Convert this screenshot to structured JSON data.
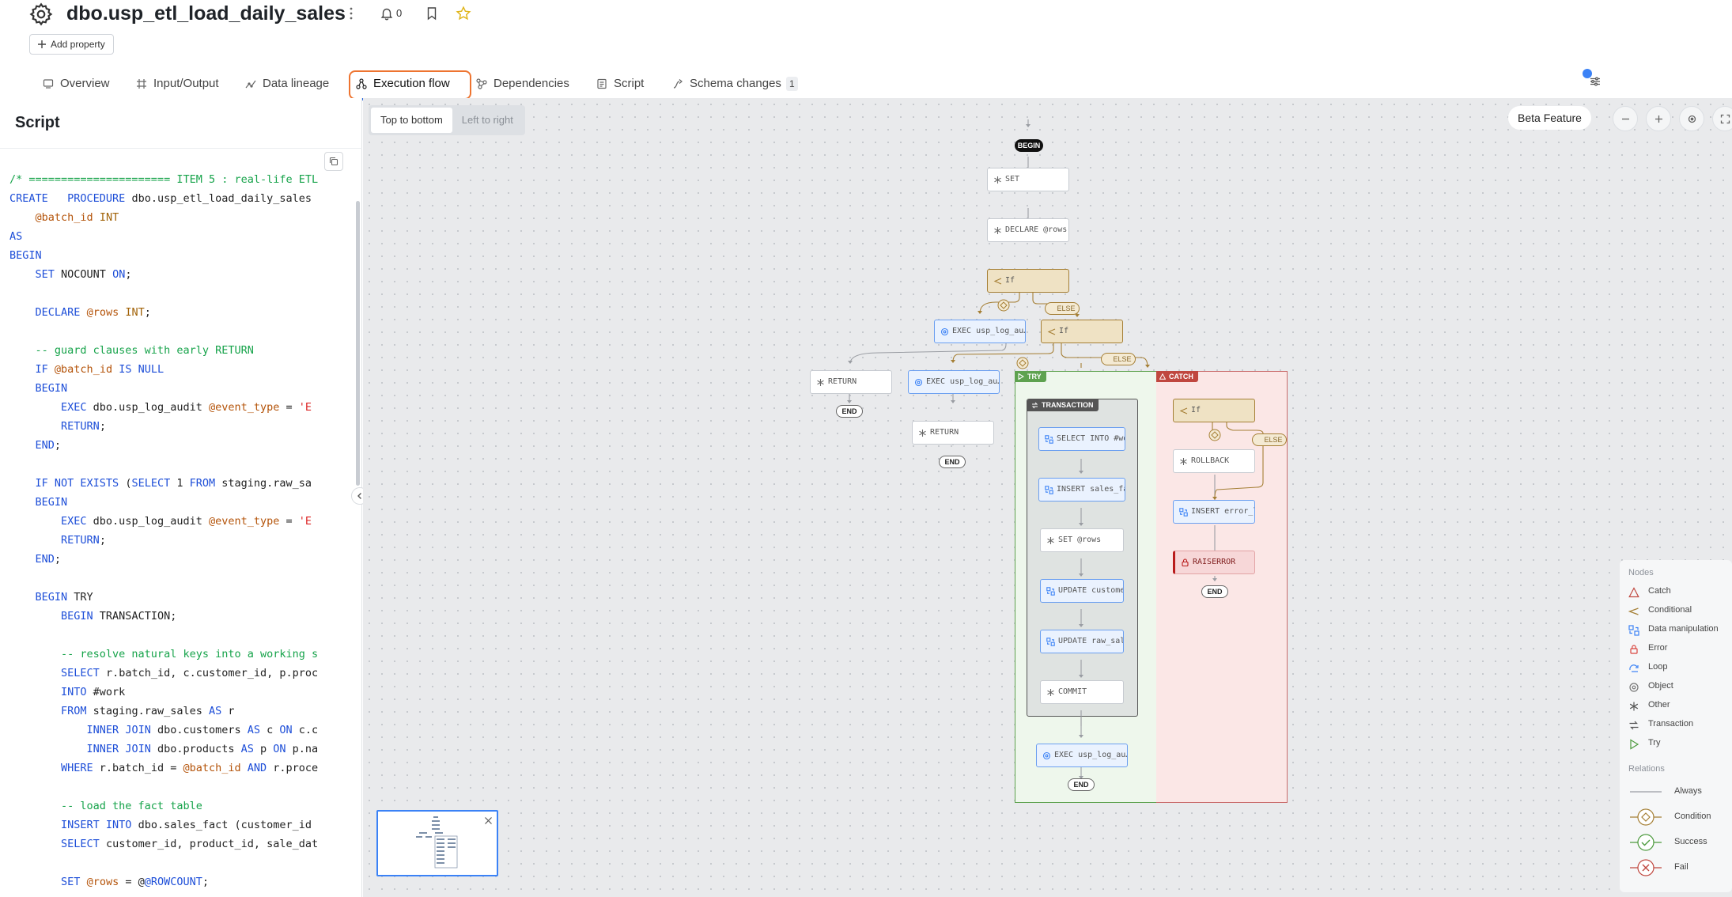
{
  "header": {
    "title": "dbo.usp_etl_load_daily_sales",
    "notifications_count": "0",
    "add_property_label": "Add property"
  },
  "tabs": [
    {
      "label": "Overview"
    },
    {
      "label": "Input/Output"
    },
    {
      "label": "Data lineage"
    },
    {
      "label": "Execution flow"
    },
    {
      "label": "Dependencies"
    },
    {
      "label": "Script"
    },
    {
      "label": "Schema changes",
      "badge": "1"
    }
  ],
  "active_tab": "Execution flow",
  "script_panel": {
    "title": "Script",
    "lines": [
      [
        {
          "t": "/* ====================== ITEM 5 : real-life ETL",
          "c": "cc"
        }
      ],
      [
        {
          "t": "CREATE   PROCEDURE",
          "c": "kw"
        },
        {
          "t": " dbo.usp_etl_load_daily_sales",
          "c": ""
        }
      ],
      [
        {
          "t": "    ",
          "c": ""
        },
        {
          "t": "@batch_id",
          "c": "vr"
        },
        {
          "t": " ",
          "c": ""
        },
        {
          "t": "INT",
          "c": "ty"
        }
      ],
      [
        {
          "t": "AS",
          "c": "kw"
        }
      ],
      [
        {
          "t": "BEGIN",
          "c": "kw"
        }
      ],
      [
        {
          "t": "    ",
          "c": ""
        },
        {
          "t": "SET",
          "c": "kw"
        },
        {
          "t": " NOCOUNT ",
          "c": ""
        },
        {
          "t": "ON",
          "c": "kw"
        },
        {
          "t": ";",
          "c": ""
        }
      ],
      [
        {
          "t": "",
          "c": ""
        }
      ],
      [
        {
          "t": "    ",
          "c": ""
        },
        {
          "t": "DECLARE",
          "c": "kw"
        },
        {
          "t": " ",
          "c": ""
        },
        {
          "t": "@rows",
          "c": "vr"
        },
        {
          "t": " ",
          "c": ""
        },
        {
          "t": "INT",
          "c": "ty"
        },
        {
          "t": ";",
          "c": ""
        }
      ],
      [
        {
          "t": "",
          "c": ""
        }
      ],
      [
        {
          "t": "    -- guard clauses with early RETURN",
          "c": "cc"
        }
      ],
      [
        {
          "t": "    ",
          "c": ""
        },
        {
          "t": "IF",
          "c": "kw"
        },
        {
          "t": " ",
          "c": ""
        },
        {
          "t": "@batch_id",
          "c": "vr"
        },
        {
          "t": " ",
          "c": ""
        },
        {
          "t": "IS NULL",
          "c": "kw"
        }
      ],
      [
        {
          "t": "    ",
          "c": ""
        },
        {
          "t": "BEGIN",
          "c": "kw"
        }
      ],
      [
        {
          "t": "        ",
          "c": ""
        },
        {
          "t": "EXEC",
          "c": "kw"
        },
        {
          "t": " dbo.usp_log_audit ",
          "c": ""
        },
        {
          "t": "@event_type",
          "c": "vr"
        },
        {
          "t": " = ",
          "c": ""
        },
        {
          "t": "'E",
          "c": "st"
        }
      ],
      [
        {
          "t": "        ",
          "c": ""
        },
        {
          "t": "RETURN",
          "c": "kw"
        },
        {
          "t": ";",
          "c": ""
        }
      ],
      [
        {
          "t": "    ",
          "c": ""
        },
        {
          "t": "END",
          "c": "kw"
        },
        {
          "t": ";",
          "c": ""
        }
      ],
      [
        {
          "t": "",
          "c": ""
        }
      ],
      [
        {
          "t": "    ",
          "c": ""
        },
        {
          "t": "IF NOT EXISTS",
          "c": "kw"
        },
        {
          "t": " (",
          "c": ""
        },
        {
          "t": "SELECT",
          "c": "kw"
        },
        {
          "t": " 1 ",
          "c": ""
        },
        {
          "t": "FROM",
          "c": "kw"
        },
        {
          "t": " staging.raw_sa",
          "c": ""
        }
      ],
      [
        {
          "t": "    ",
          "c": ""
        },
        {
          "t": "BEGIN",
          "c": "kw"
        }
      ],
      [
        {
          "t": "        ",
          "c": ""
        },
        {
          "t": "EXEC",
          "c": "kw"
        },
        {
          "t": " dbo.usp_log_audit ",
          "c": ""
        },
        {
          "t": "@event_type",
          "c": "vr"
        },
        {
          "t": " = ",
          "c": ""
        },
        {
          "t": "'E",
          "c": "st"
        }
      ],
      [
        {
          "t": "        ",
          "c": ""
        },
        {
          "t": "RETURN",
          "c": "kw"
        },
        {
          "t": ";",
          "c": ""
        }
      ],
      [
        {
          "t": "    ",
          "c": ""
        },
        {
          "t": "END",
          "c": "kw"
        },
        {
          "t": ";",
          "c": ""
        }
      ],
      [
        {
          "t": "",
          "c": ""
        }
      ],
      [
        {
          "t": "    ",
          "c": ""
        },
        {
          "t": "BEGIN",
          "c": "kw"
        },
        {
          "t": " TRY",
          "c": ""
        }
      ],
      [
        {
          "t": "        ",
          "c": ""
        },
        {
          "t": "BEGIN",
          "c": "kw"
        },
        {
          "t": " TRANSACTION;",
          "c": ""
        }
      ],
      [
        {
          "t": "",
          "c": ""
        }
      ],
      [
        {
          "t": "        -- resolve natural keys into a working s",
          "c": "cc"
        }
      ],
      [
        {
          "t": "        ",
          "c": ""
        },
        {
          "t": "SELECT",
          "c": "kw"
        },
        {
          "t": " r.batch_id, c.customer_id, p.proc",
          "c": ""
        }
      ],
      [
        {
          "t": "        ",
          "c": ""
        },
        {
          "t": "INTO",
          "c": "kw"
        },
        {
          "t": " #work",
          "c": ""
        }
      ],
      [
        {
          "t": "        ",
          "c": ""
        },
        {
          "t": "FROM",
          "c": "kw"
        },
        {
          "t": " staging.raw_sales ",
          "c": ""
        },
        {
          "t": "AS",
          "c": "kw"
        },
        {
          "t": " r",
          "c": ""
        }
      ],
      [
        {
          "t": "            ",
          "c": ""
        },
        {
          "t": "INNER JOIN",
          "c": "kw"
        },
        {
          "t": " dbo.customers ",
          "c": ""
        },
        {
          "t": "AS",
          "c": "kw"
        },
        {
          "t": " c ",
          "c": ""
        },
        {
          "t": "ON",
          "c": "kw"
        },
        {
          "t": " c.c",
          "c": ""
        }
      ],
      [
        {
          "t": "            ",
          "c": ""
        },
        {
          "t": "INNER JOIN",
          "c": "kw"
        },
        {
          "t": " dbo.products ",
          "c": ""
        },
        {
          "t": "AS",
          "c": "kw"
        },
        {
          "t": " p ",
          "c": ""
        },
        {
          "t": "ON",
          "c": "kw"
        },
        {
          "t": " p.na",
          "c": ""
        }
      ],
      [
        {
          "t": "        ",
          "c": ""
        },
        {
          "t": "WHERE",
          "c": "kw"
        },
        {
          "t": " r.batch_id = ",
          "c": ""
        },
        {
          "t": "@batch_id",
          "c": "vr"
        },
        {
          "t": " ",
          "c": ""
        },
        {
          "t": "AND",
          "c": "kw"
        },
        {
          "t": " r.proce",
          "c": ""
        }
      ],
      [
        {
          "t": "",
          "c": ""
        }
      ],
      [
        {
          "t": "        -- load the fact table",
          "c": "cc"
        }
      ],
      [
        {
          "t": "        ",
          "c": ""
        },
        {
          "t": "INSERT INTO",
          "c": "kw"
        },
        {
          "t": " dbo.sales_fact (customer_id",
          "c": ""
        }
      ],
      [
        {
          "t": "        ",
          "c": ""
        },
        {
          "t": "SELECT",
          "c": "kw"
        },
        {
          "t": " customer_id, product_id, sale_dat",
          "c": ""
        }
      ],
      [
        {
          "t": "",
          "c": ""
        }
      ],
      [
        {
          "t": "        ",
          "c": ""
        },
        {
          "t": "SET",
          "c": "kw"
        },
        {
          "t": " ",
          "c": ""
        },
        {
          "t": "@rows",
          "c": "vr"
        },
        {
          "t": " = @",
          "c": ""
        },
        {
          "t": "@ROWCOUNT",
          "c": "kw"
        },
        {
          "t": ";",
          "c": ""
        }
      ]
    ]
  },
  "canvas": {
    "layout_options": [
      "Top to bottom",
      "Left to right"
    ],
    "selected_layout": "Top to bottom",
    "beta_label": "Beta Feature",
    "nodes": {
      "begin": "BEGIN",
      "set": "SET",
      "declare": "DECLARE @rows",
      "if1": "If",
      "exec1": "EXEC usp_log_au…",
      "if2": "If",
      "return1": "RETURN",
      "exec2": "EXEC usp_log_au…",
      "return2": "RETURN",
      "select_into": "SELECT INTO #wo…",
      "insert_sales": "INSERT sales_fa…",
      "set_rows": "SET @rows",
      "update_customer": "UPDATE custome…",
      "update_raw": "UPDATE raw_sal…",
      "commit": "COMMIT",
      "exec3": "EXEC usp_log_au…",
      "if3": "If",
      "rollback": "ROLLBACK",
      "insert_error": "INSERT error_l…",
      "raiserror": "RAISERROR",
      "end": "END",
      "else": "ELSE"
    },
    "zones": {
      "try": "TRY",
      "catch": "CATCH",
      "transaction": "TRANSACTION"
    }
  },
  "legend": {
    "nodes_title": "Nodes",
    "nodes": [
      "Catch",
      "Conditional",
      "Data manipulation",
      "Error",
      "Loop",
      "Object",
      "Other",
      "Transaction",
      "Try"
    ],
    "relations_title": "Relations",
    "relations": [
      "Always",
      "Condition",
      "Success",
      "Fail"
    ]
  },
  "colors": {
    "accent": "#2d6ae3",
    "highlight_outline": "#ee7430",
    "conditional": "#a57f35",
    "try_zone": "#5ea24f",
    "catch_zone": "#c96b6b",
    "error": "#b91c1c"
  }
}
